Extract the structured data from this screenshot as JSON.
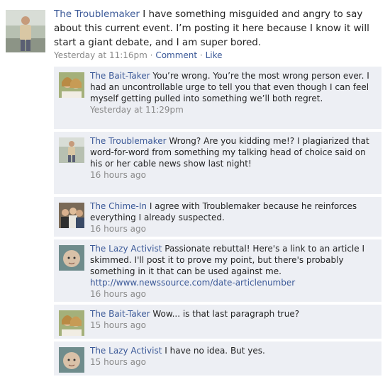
{
  "post": {
    "author": "The Troublemaker",
    "text": "I have something misguided and angry to say about this current event. I’m posting it here because I know it will start a giant debate, and I am super bored.",
    "timestamp": "Yesterday at 11:16pm",
    "separator": "·",
    "comment_label": "Comment",
    "like_label": "Like"
  },
  "comments": [
    {
      "author": "The Bait-Taker",
      "text": "You’re wrong. You’re the most wrong person ever. I had an uncontrollable urge to tell you that even though I can feel myself getting pulled into something we’ll both regret.",
      "time": "Yesterday at 11:29pm",
      "avatar": "two-women-avatar-icon"
    },
    {
      "author": "The Troublemaker",
      "text": "Wrong? Are you kidding me!? I plagiarized that word-for-word from something my talking head of choice said on his or her cable news show last night!",
      "time": "16 hours ago",
      "avatar": "standing-man-avatar-icon"
    },
    {
      "author": "The Chime-In",
      "text": "I agree with Troublemaker because he reinforces everything I already suspected.",
      "time": "16 hours ago",
      "avatar": "group-avatar-icon"
    },
    {
      "author": "The Lazy Activist",
      "text": "Passionate rebuttal! Here's a link to an article I skimmed. I'll post it to prove my point, but there's probably something in it that can be used against me.",
      "url": "http://www.newssource.com/date-articlenumber",
      "time": "16 hours ago",
      "avatar": "baby-avatar-icon"
    },
    {
      "author": "The Bait-Taker",
      "text": "Wow... is that last paragraph true?",
      "time": "15 hours ago",
      "avatar": "two-women-avatar-icon"
    },
    {
      "author": "The Lazy Activist",
      "text": "I have no idea. But yes.",
      "time": "15 hours ago",
      "avatar": "baby-avatar-icon"
    }
  ]
}
